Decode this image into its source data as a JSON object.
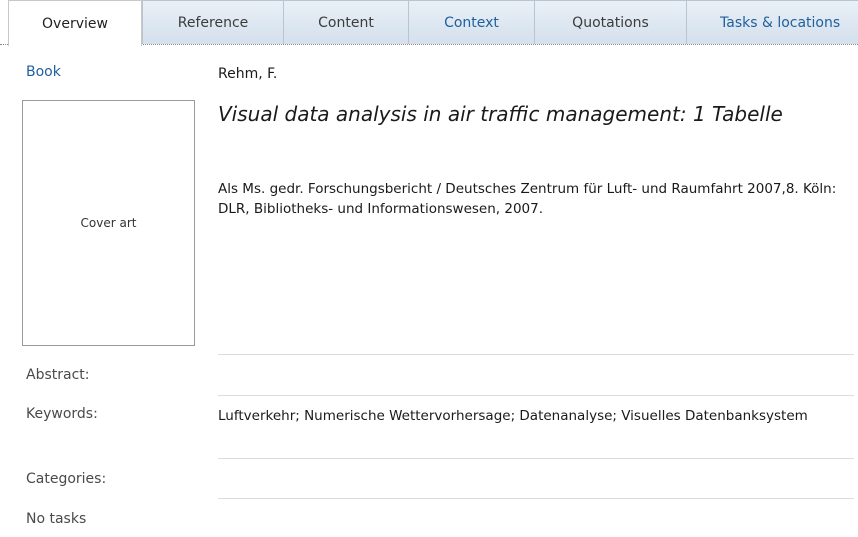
{
  "tabs": [
    {
      "label": "Overview",
      "active": true
    },
    {
      "label": "Reference",
      "active": false
    },
    {
      "label": "Content",
      "active": false
    },
    {
      "label": "Context",
      "active": false
    },
    {
      "label": "Quotations",
      "active": false
    },
    {
      "label": "Tasks & locations",
      "active": false
    }
  ],
  "reference": {
    "type": "Book",
    "cover_label": "Cover art",
    "author": "Rehm, F.",
    "title": "Visual data analysis in air traffic management: 1 Tabelle",
    "imprint": "Als Ms. gedr. Forschungsbericht / Deutsches Zentrum für Luft- und Raumfahrt 2007,8. Köln: DLR, Bibliotheks- und Informationswesen, 2007."
  },
  "fields": {
    "abstract_label": "Abstract:",
    "abstract_value": "",
    "keywords_label": "Keywords:",
    "keywords_value": "Luftverkehr; Numerische Wettervorhersage; Datenanalyse; Visuelles Datenbanksystem",
    "categories_label": "Categories:",
    "categories_value": "",
    "tasks_label": "No tasks"
  },
  "colors": {
    "link": "#1e5f9e",
    "tab_gradient_top": "#e9f0f7",
    "tab_gradient_bottom": "#d4e0ec",
    "divider": "#dcdcdc"
  }
}
